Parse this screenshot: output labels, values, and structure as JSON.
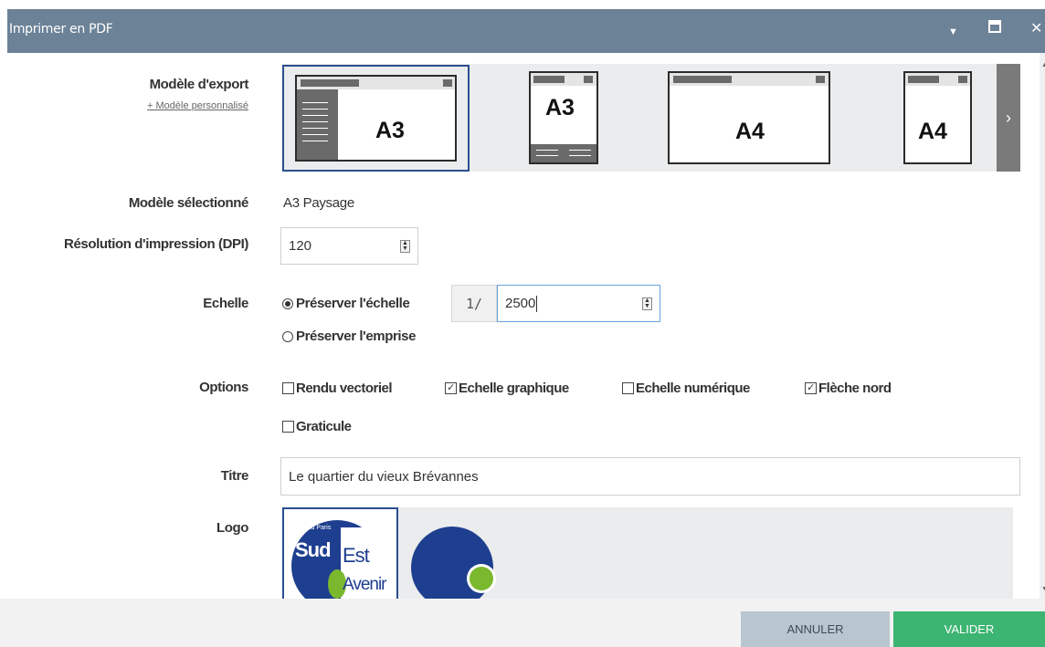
{
  "window": {
    "title": "Imprimer en PDF",
    "controls": {
      "collapse": "▼",
      "maximize": "❐",
      "close": "✕"
    }
  },
  "export_model": {
    "label": "Modèle d'export",
    "custom_link": "+ Modèle personnalisé",
    "templates": [
      {
        "format": "A3",
        "orientation": "paysage",
        "selected": true
      },
      {
        "format": "A3",
        "orientation": "portrait",
        "selected": false
      },
      {
        "format": "A4",
        "orientation": "paysage",
        "selected": false
      },
      {
        "format": "A4",
        "orientation": "portrait",
        "selected": false
      }
    ],
    "next_arrow": "›"
  },
  "selected_model": {
    "label": "Modèle sélectionné",
    "value": "A3 Paysage"
  },
  "resolution": {
    "label": "Résolution d'impression (DPI)",
    "value": "120"
  },
  "scale": {
    "label": "Echelle",
    "option_preserve_scale": "Préserver l'échelle",
    "option_preserve_extent": "Préserver l'emprise",
    "selected": "preserve_scale",
    "prefix": "1/",
    "value": "2500"
  },
  "options": {
    "label": "Options",
    "items": [
      {
        "label": "Rendu vectoriel",
        "checked": false
      },
      {
        "label": "Echelle graphique",
        "checked": true
      },
      {
        "label": "Echelle numérique",
        "checked": false
      },
      {
        "label": "Flèche nord",
        "checked": true
      },
      {
        "label": "Graticule",
        "checked": false
      }
    ]
  },
  "title_field": {
    "label": "Titre",
    "value": "Le quartier du vieux Brévannes"
  },
  "logo": {
    "label": "Logo",
    "options": [
      {
        "name": "grand-paris-sud-est-avenir",
        "lines": [
          "Grand Paris",
          "Sud",
          "Est",
          "Avenir"
        ],
        "selected": true
      },
      {
        "name": "circle-logo",
        "selected": false
      }
    ],
    "colors": {
      "blue": "#1e3f8f",
      "green": "#7ab82e"
    }
  },
  "footer": {
    "cancel_label": "ANNULER",
    "ok_label": "VALIDER"
  },
  "colors": {
    "titlebar": "#6c8297",
    "accent_border": "#2a4f8f",
    "validate": "#3cb572",
    "cancel": "#b9c6cf"
  }
}
